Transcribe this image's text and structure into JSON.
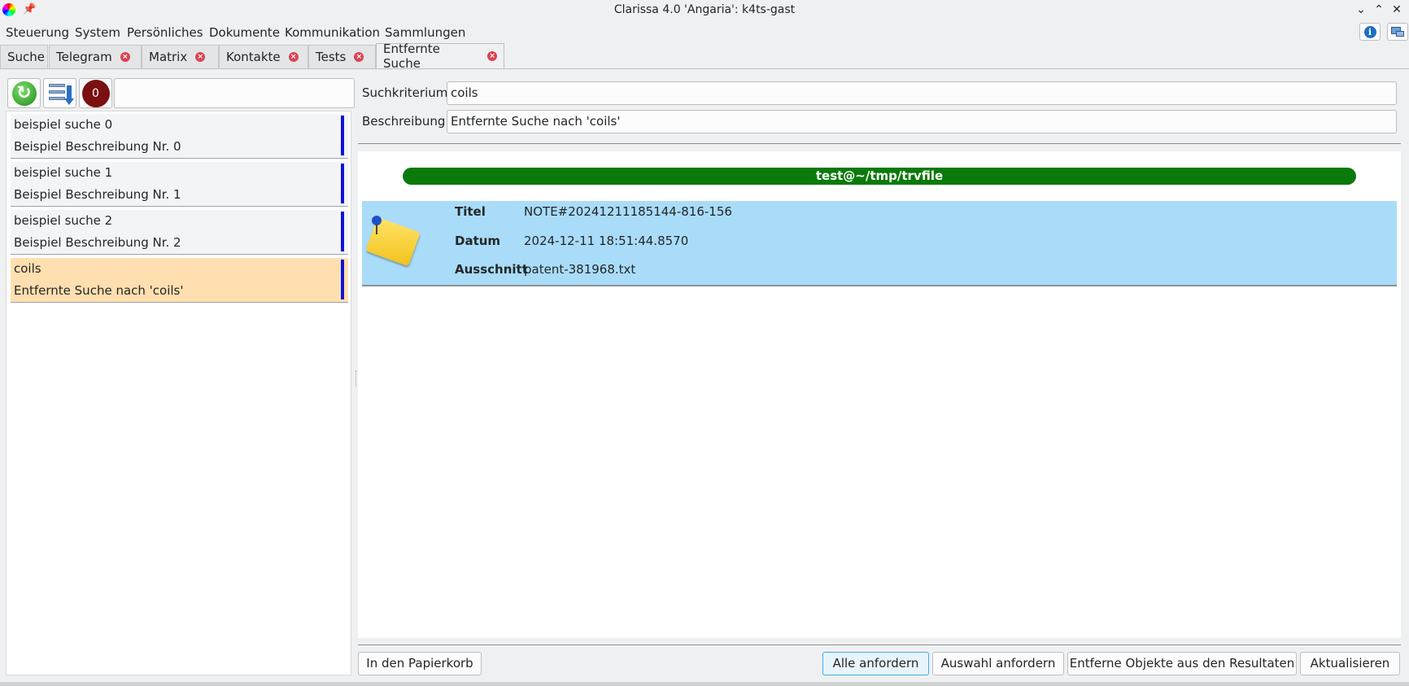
{
  "window": {
    "title": "Clarissa 4.0 'Angaria': k4ts-gast"
  },
  "menu": [
    "Steuerung",
    "System",
    "Persönliches",
    "Dokumente",
    "Kommunikation",
    "Sammlungen"
  ],
  "tabs": [
    {
      "label": "Suche",
      "closable": false
    },
    {
      "label": "Telegram",
      "closable": true
    },
    {
      "label": "Matrix",
      "closable": true
    },
    {
      "label": "Kontakte",
      "closable": true
    },
    {
      "label": "Tests",
      "closable": true
    },
    {
      "label": "Entfernte Suche",
      "closable": true,
      "active": true
    }
  ],
  "toolbar": {
    "count_badge": "0",
    "filter_value": ""
  },
  "searches": [
    {
      "name": "beispiel suche 0",
      "desc": "Beispiel Beschreibung Nr. 0"
    },
    {
      "name": "beispiel suche 1",
      "desc": "Beispiel Beschreibung Nr. 1"
    },
    {
      "name": "beispiel suche 2",
      "desc": "Beispiel Beschreibung Nr. 2"
    },
    {
      "name": "coils",
      "desc": "Entfernte Suche nach 'coils'",
      "selected": true
    }
  ],
  "form": {
    "criterion_label": "Suchkriterium",
    "criterion_value": "coils",
    "description_label": "Beschreibung",
    "description_value": "Entfernte Suche nach 'coils'"
  },
  "results": {
    "source": "test@~/tmp/trvfile",
    "items": [
      {
        "title_label": "Titel",
        "title": "NOTE#20241211185144-816-156",
        "date_label": "Datum",
        "date": "2024-12-11 18:51:44.8570",
        "excerpt_label": "Ausschnitt",
        "excerpt": "patent-381968.txt"
      }
    ]
  },
  "buttons": {
    "trash": "In den Papierkorb",
    "request_all": "Alle anfordern",
    "request_selection": "Auswahl anfordern",
    "remove_remote": "Entferne Objekte aus den Resultaten",
    "refresh": "Aktualisieren"
  },
  "colors": {
    "accent_green": "#0a7a0a",
    "selection_orange": "#ffdfaf",
    "result_blue": "#a9dcf9",
    "marker_blue": "#0f13d6"
  }
}
